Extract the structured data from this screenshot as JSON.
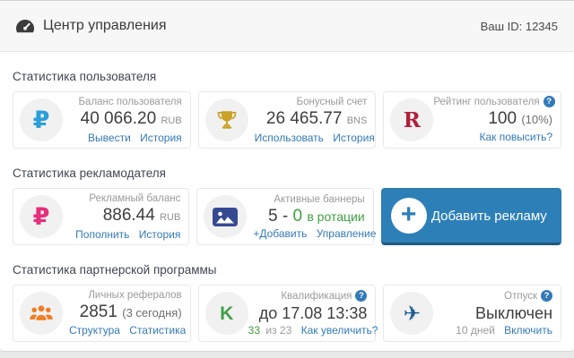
{
  "header": {
    "title": "Центр управления",
    "user_id": "Ваш ID: 12345"
  },
  "sections": {
    "user": {
      "title": "Статистика пользователя"
    },
    "advertiser": {
      "title": "Статистика рекламодателя"
    },
    "partner": {
      "title": "Статистика партнерской программы"
    }
  },
  "glyphs": {
    "ruble": "₽",
    "rating_letter": "R",
    "qualification_letter": "K",
    "plane": "✈",
    "plus": "+",
    "help": "?"
  },
  "cards": {
    "balance": {
      "label": "Баланс пользователя",
      "value": "40 066.20",
      "unit": "RUB",
      "link1": "Вывести",
      "link2": "История"
    },
    "bonus": {
      "label": "Бонусный счет",
      "value": "26 465.77",
      "unit": "BNS",
      "link1": "Использовать",
      "link2": "История"
    },
    "rating": {
      "label": "Рейтинг пользователя",
      "value": "100",
      "suffix": "(10%)",
      "link1": "Как повысить?"
    },
    "adv_balance": {
      "label": "Рекламный баланс",
      "value": "886.44",
      "unit": "RUB",
      "link1": "Пополнить",
      "link2": "История"
    },
    "banners": {
      "label": "Активные баннеры",
      "value_dark": "5 -",
      "value_green": "0",
      "value_tail": "в ротации",
      "link1": "+Добавить",
      "link2": "Управление"
    },
    "add_ad_button": {
      "label": "Добавить рекламу"
    },
    "referrals": {
      "label": "Личных рефералов",
      "value": "2851",
      "suffix": "(3 сегодня)",
      "link1": "Структура",
      "link2": "Статистика"
    },
    "qualification": {
      "label": "Квалификация",
      "value": "до 17.08 13:38",
      "progress_current": "33",
      "progress_of": "из 23",
      "link1": "Как увеличить?"
    },
    "vacation": {
      "label": "Отпуск",
      "value": "Выключен",
      "days": "10 дней",
      "link1": "Включить"
    }
  },
  "colors": {
    "accent_button_blue": "#2d7fb8",
    "link_blue": "#337ab7",
    "positive_green": "#3fa040",
    "ruble_blue": "#2b9fd9",
    "ruble_pink": "#e62e7b",
    "trophy_gold": "#c9a227",
    "rating_red": "#b11f3a",
    "banner_navy": "#364a93",
    "referrals_orange": "#ef7d22",
    "qualification_green": "#43a047",
    "plane_navy": "#1d5b94"
  }
}
